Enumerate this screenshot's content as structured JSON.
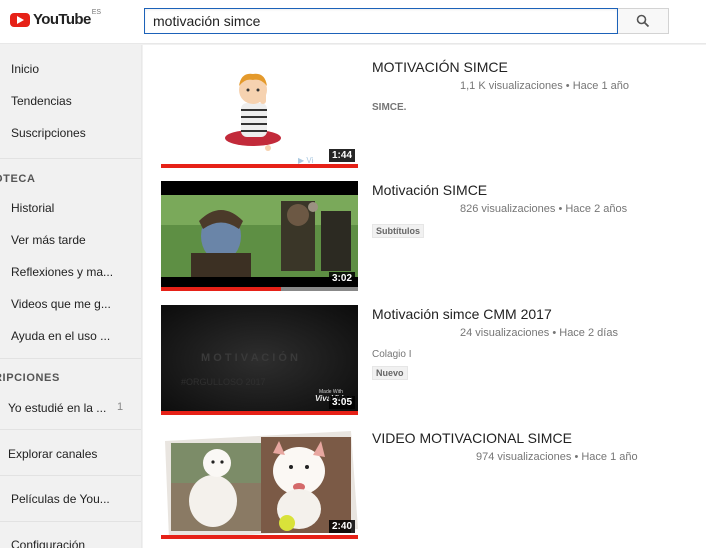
{
  "header": {
    "logo_text": "YouTube",
    "region": "ES",
    "search_value": "motivación simce",
    "search_icon": "search-icon"
  },
  "sidebar": {
    "items": [
      {
        "label": "Inicio"
      },
      {
        "label": "Tendencias"
      },
      {
        "label": "Suscripciones"
      }
    ],
    "library_heading": "OTECA",
    "library_items": [
      {
        "label": "Historial"
      },
      {
        "label": "Ver más tarde"
      },
      {
        "label": "Reflexiones y ma..."
      },
      {
        "label": "Videos que me g..."
      },
      {
        "label": "Ayuda en el uso ..."
      }
    ],
    "subs_heading": "RIPCIONES",
    "subs_items": [
      {
        "label": "Yo estudié en la ...",
        "count": "1"
      }
    ],
    "explore": "Explorar canales",
    "movies": "Películas de You...",
    "settings": "Configuración"
  },
  "results": [
    {
      "title": "MOTIVACIÓN SIMCE",
      "views": "1,1 K visualizaciones",
      "age": "Hace 1 año",
      "description": "SIMCE.",
      "badge": "",
      "duration": "1:44",
      "progress": 1.0
    },
    {
      "title": "Motivación SIMCE",
      "views": "826 visualizaciones",
      "age": "Hace 2 años",
      "description": "",
      "badge": "Subtítulos",
      "duration": "3:02",
      "progress": 0.61
    },
    {
      "title": "Motivación simce CMM 2017",
      "views": "24 visualizaciones",
      "age": "Hace 2 días",
      "description": "Colagio I",
      "badge": "Nuevo",
      "duration": "3:05",
      "progress": 1.0
    },
    {
      "title": "VIDEO MOTIVACIONAL SIMCE",
      "views": "974 visualizaciones",
      "age": "Hace 1 año",
      "description": "",
      "badge": "",
      "duration": "2:40",
      "progress": 1.0
    }
  ],
  "colors": {
    "accent": "#e62117",
    "search_border": "#1c62b9"
  }
}
